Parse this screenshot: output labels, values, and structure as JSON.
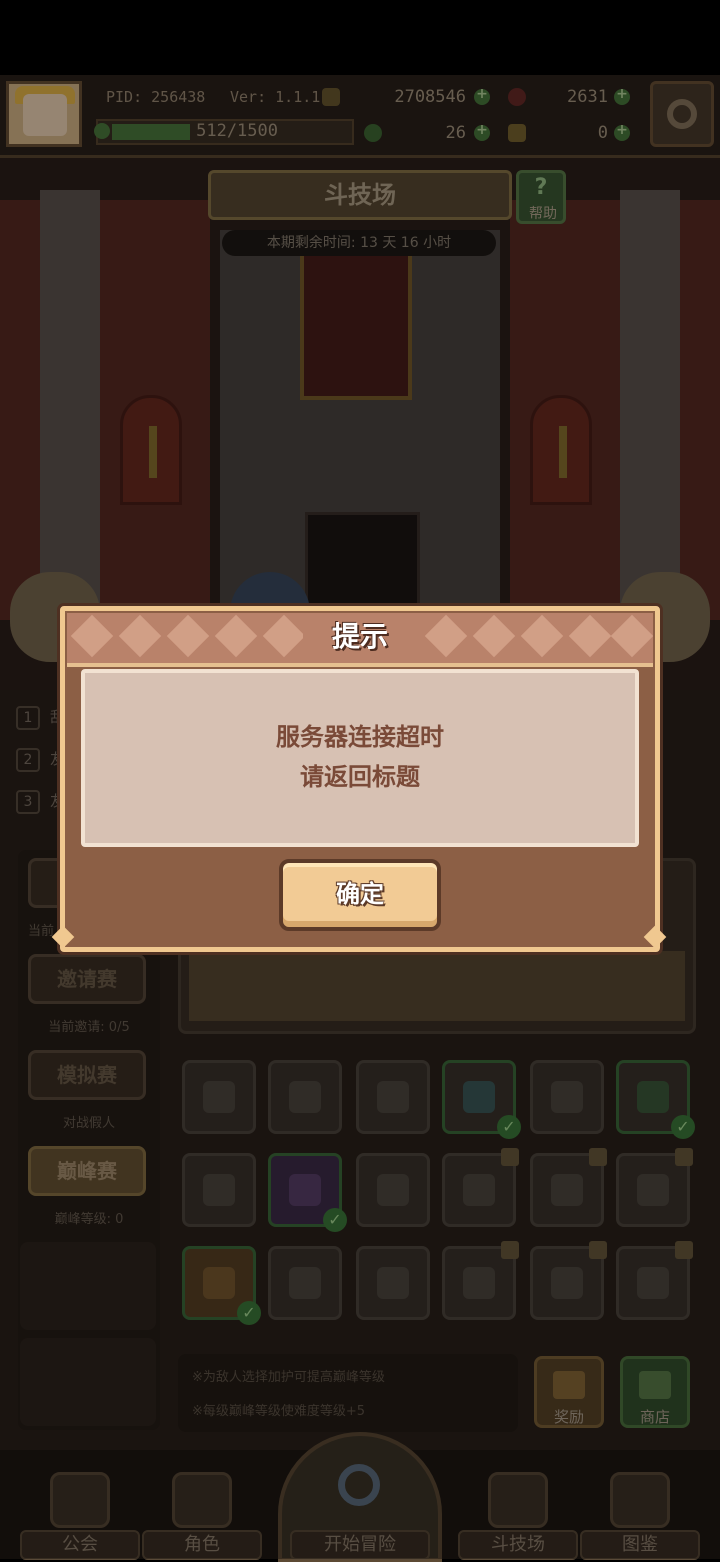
{
  "hud": {
    "pid": "PID: 256438",
    "version": "Ver: 1.1.1.9",
    "gold": "2708546",
    "gems": "2631",
    "energy": "512/1500",
    "energy_fraction": 0.34,
    "clover": "26",
    "keys": "0"
  },
  "arena": {
    "title": "斗技场",
    "help_label": "帮助",
    "season_timer": "本期剩余时间: 13 天 16 小时"
  },
  "rank_list": [
    {
      "num": "1",
      "text": "乱"
    },
    {
      "num": "2",
      "text": "友"
    },
    {
      "num": "3",
      "text": "友"
    }
  ],
  "modes": {
    "current_label": "当前",
    "invite": "邀请赛",
    "invite_sub": "当前邀请: 0/5",
    "mock": "模拟赛",
    "mock_sub": "对战假人",
    "peak": "巅峰赛",
    "peak_sub": "巅峰等级: 0"
  },
  "hints": {
    "line1": "※为敌人选择加护可提高巅峰等级",
    "line2": "※每级巅峰等级使难度等级+5"
  },
  "buttons": {
    "reward": "奖励",
    "shop": "商店"
  },
  "nav": {
    "guild": "公会",
    "character": "角色",
    "adventure": "开始冒险",
    "arena": "斗技场",
    "codex": "图鉴"
  },
  "dialog": {
    "title": "提示",
    "line1": "服务器连接超时",
    "line2": "请返回标题",
    "confirm": "确定"
  },
  "colors": {
    "dialog_frame": "#f0c890",
    "dialog_bg": "#8c5f45",
    "dialog_body": "#d7c1b3",
    "message_text": "#7a4a38",
    "confirm_bg": "#f2cb95"
  }
}
